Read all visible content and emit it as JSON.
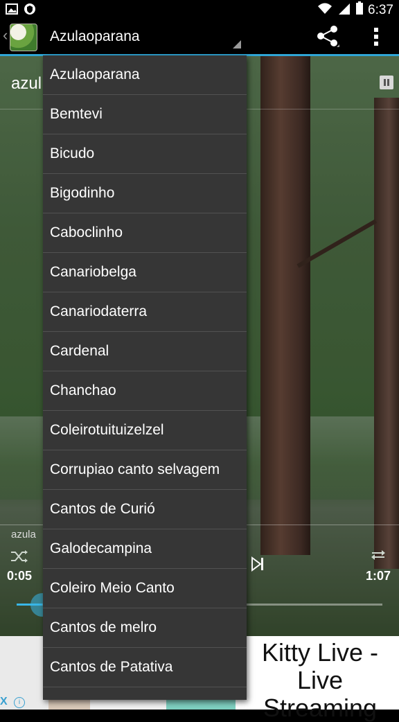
{
  "status_bar": {
    "time": "6:37",
    "left_icons": [
      "image-notification-icon",
      "shield-icon"
    ],
    "right_icons": [
      "wifi-icon",
      "signal-icon",
      "battery-icon"
    ]
  },
  "action_bar": {
    "title": "Azulaoparana",
    "icons": [
      "app-icon",
      "share-icon",
      "overflow-menu-icon"
    ],
    "accent_color": "#2fa6d6"
  },
  "player": {
    "song_title": "azul",
    "song_subtitle": "azula",
    "current_time": "0:05",
    "total_time": "1:07",
    "progress": 0.07
  },
  "dropdown": {
    "items": [
      "Azulaoparana",
      "Bemtevi",
      "Bicudo",
      "Bigodinho",
      "Caboclinho",
      "Canariobelga",
      "Canariodaterra",
      "Cardenal",
      "Chanchao",
      "Coleirotuituizelzel",
      "Corrupiao canto selvagem",
      "Cantos de Curió",
      "Galodecampina",
      "Coleiro Meio Canto",
      "Cantos de melro",
      "Cantos de Patativa"
    ]
  },
  "ad": {
    "headline": "Kitty Live - Live Streaming",
    "close_label": "X",
    "info_label": "i"
  }
}
